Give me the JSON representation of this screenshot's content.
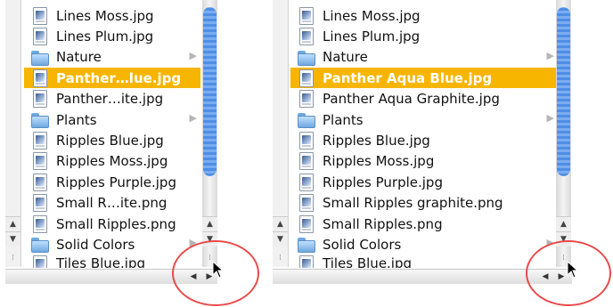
{
  "panels": [
    {
      "id": "left",
      "files": [
        {
          "name": "Lines Moss.jpg",
          "type": "file"
        },
        {
          "name": "Lines Plum.jpg",
          "type": "file"
        },
        {
          "name": "Nature",
          "type": "folder"
        },
        {
          "name": "Panther…lue.jpg",
          "type": "file",
          "selected": true
        },
        {
          "name": "Panther…ite.jpg",
          "type": "file"
        },
        {
          "name": "Plants",
          "type": "folder"
        },
        {
          "name": "Ripples Blue.jpg",
          "type": "file"
        },
        {
          "name": "Ripples Moss.jpg",
          "type": "file"
        },
        {
          "name": "Ripples Purple.jpg",
          "type": "file"
        },
        {
          "name": "Small R…ite.png",
          "type": "file"
        },
        {
          "name": "Small Ripples.png",
          "type": "file"
        },
        {
          "name": "Solid Colors",
          "type": "folder"
        },
        {
          "name": "Tiles Blue.jpg",
          "type": "file",
          "partial": true
        }
      ]
    },
    {
      "id": "right",
      "files": [
        {
          "name": "Lines Moss.jpg",
          "type": "file"
        },
        {
          "name": "Lines Plum.jpg",
          "type": "file"
        },
        {
          "name": "Nature",
          "type": "folder"
        },
        {
          "name": "Panther Aqua Blue.jpg",
          "type": "file",
          "selected": true
        },
        {
          "name": "Panther Aqua Graphite.jpg",
          "type": "file"
        },
        {
          "name": "Plants",
          "type": "folder"
        },
        {
          "name": "Ripples Blue.jpg",
          "type": "file"
        },
        {
          "name": "Ripples Moss.jpg",
          "type": "file"
        },
        {
          "name": "Ripples Purple.jpg",
          "type": "file"
        },
        {
          "name": "Small Ripples graphite.png",
          "type": "file"
        },
        {
          "name": "Small Ripples.png",
          "type": "file"
        },
        {
          "name": "Solid Colors",
          "type": "folder"
        },
        {
          "name": "Tiles Blue.jpg",
          "type": "file",
          "partial": true
        }
      ]
    }
  ],
  "icons": {
    "folder_arrow": "▶",
    "scroll_up": "▲",
    "scroll_down": "▼",
    "scroll_left": "◀",
    "scroll_right": "▶",
    "grip": "⁞"
  },
  "colors": {
    "selection": "#f7b500",
    "scroll_thumb": "#4f8ee6",
    "annotation_circle": "#ea4a4a"
  }
}
